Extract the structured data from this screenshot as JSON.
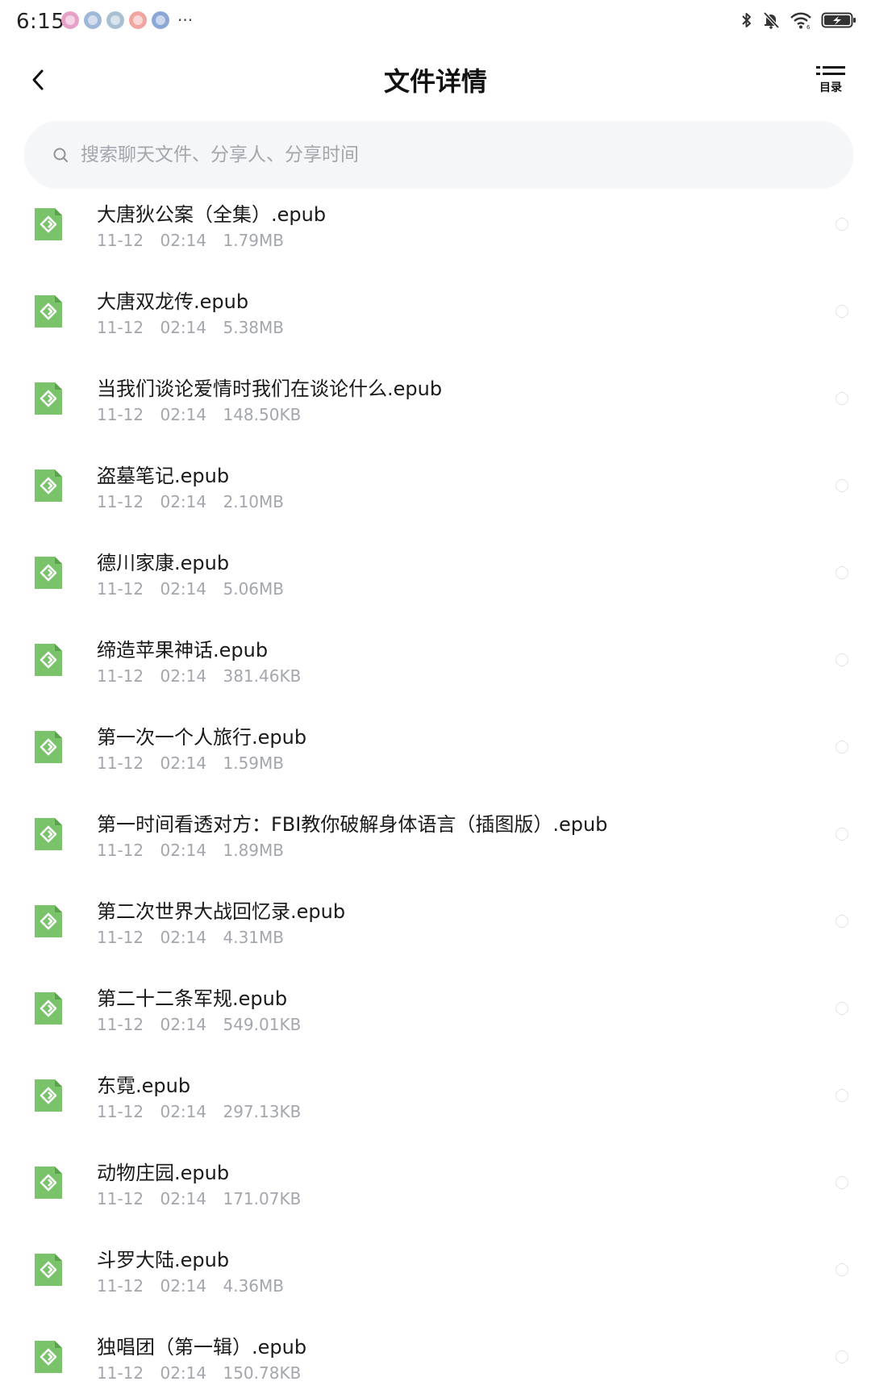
{
  "status_bar": {
    "time": "6:15",
    "notification_colors": [
      "#e7a0c8",
      "#9fb8d8",
      "#a9c0d3",
      "#f0a6a0",
      "#8aa7d6"
    ],
    "more": "···"
  },
  "header": {
    "title": "文件详情",
    "toc_label": "目录"
  },
  "search": {
    "placeholder": "搜索聊天文件、分享人、分享时间"
  },
  "accent_color": "#7ac36a",
  "files": [
    {
      "name": "大唐狄公案（全集）.epub",
      "date": "11-12",
      "time": "02:14",
      "size": "1.79MB"
    },
    {
      "name": "大唐双龙传.epub",
      "date": "11-12",
      "time": "02:14",
      "size": "5.38MB"
    },
    {
      "name": "当我们谈论爱情时我们在谈论什么.epub",
      "date": "11-12",
      "time": "02:14",
      "size": "148.50KB"
    },
    {
      "name": "盗墓笔记.epub",
      "date": "11-12",
      "time": "02:14",
      "size": "2.10MB"
    },
    {
      "name": "德川家康.epub",
      "date": "11-12",
      "time": "02:14",
      "size": "5.06MB"
    },
    {
      "name": "缔造苹果神话.epub",
      "date": "11-12",
      "time": "02:14",
      "size": "381.46KB"
    },
    {
      "name": "第一次一个人旅行.epub",
      "date": "11-12",
      "time": "02:14",
      "size": "1.59MB"
    },
    {
      "name": "第一时间看透对方：FBI教你破解身体语言（插图版）.epub",
      "date": "11-12",
      "time": "02:14",
      "size": "1.89MB"
    },
    {
      "name": "第二次世界大战回忆录.epub",
      "date": "11-12",
      "time": "02:14",
      "size": "4.31MB"
    },
    {
      "name": "第二十二条军规.epub",
      "date": "11-12",
      "time": "02:14",
      "size": "549.01KB"
    },
    {
      "name": "东霓.epub",
      "date": "11-12",
      "time": "02:14",
      "size": "297.13KB"
    },
    {
      "name": "动物庄园.epub",
      "date": "11-12",
      "time": "02:14",
      "size": "171.07KB"
    },
    {
      "name": "斗罗大陆.epub",
      "date": "11-12",
      "time": "02:14",
      "size": "4.36MB"
    },
    {
      "name": "独唱团（第一辑）.epub",
      "date": "11-12",
      "time": "02:14",
      "size": "150.78KB"
    }
  ]
}
